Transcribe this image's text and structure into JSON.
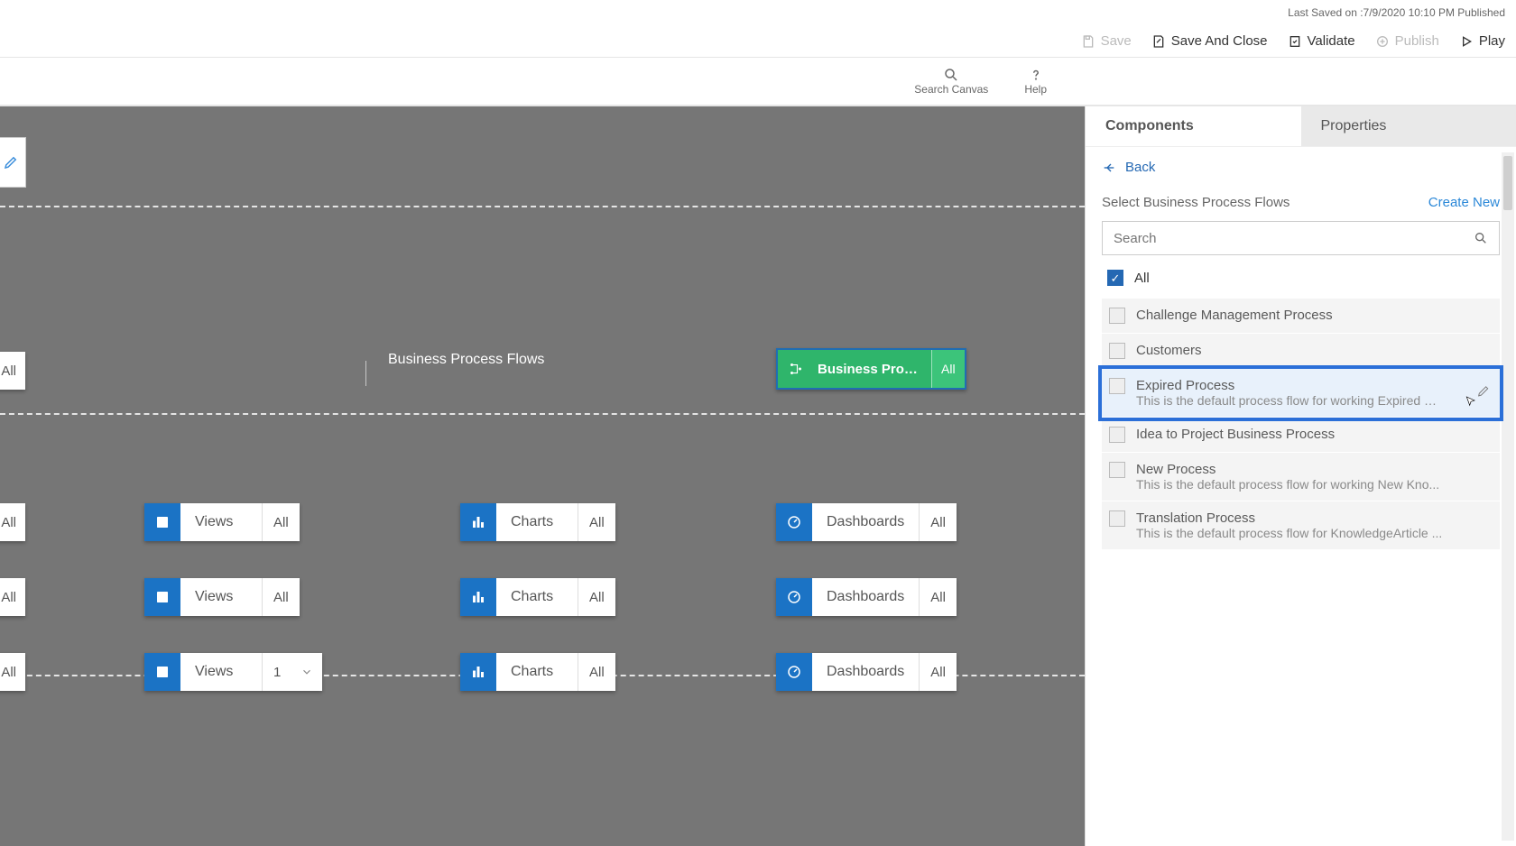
{
  "status": {
    "text": "Last Saved on :7/9/2020 10:10 PM Published"
  },
  "commands": {
    "save": "Save",
    "save_close": "Save And Close",
    "validate": "Validate",
    "publish": "Publish",
    "play": "Play"
  },
  "secondary": {
    "search": "Search Canvas",
    "help": "Help"
  },
  "canvas": {
    "edge_tag": "All",
    "bpf_lane_label": "Business Process Flows",
    "bpf_card_label": "Business Proces...",
    "bpf_card_tag": "All",
    "tiles": {
      "views": "Views",
      "charts": "Charts",
      "dashboards": "Dashboards",
      "all": "All",
      "one": "1"
    }
  },
  "panel": {
    "tab_components": "Components",
    "tab_properties": "Properties",
    "back": "Back",
    "section_title": "Select Business Process Flows",
    "create_new": "Create New",
    "search_placeholder": "Search",
    "all_label": "All",
    "items": [
      {
        "name": "Challenge Management Process",
        "desc": ""
      },
      {
        "name": "Customers",
        "desc": ""
      },
      {
        "name": "Expired Process",
        "desc": "This is the default process flow for working Expired K..."
      },
      {
        "name": "Idea to Project Business Process",
        "desc": ""
      },
      {
        "name": "New Process",
        "desc": "This is the default process flow for working New Kno..."
      },
      {
        "name": "Translation Process",
        "desc": "This is the default process flow for KnowledgeArticle ..."
      }
    ]
  }
}
